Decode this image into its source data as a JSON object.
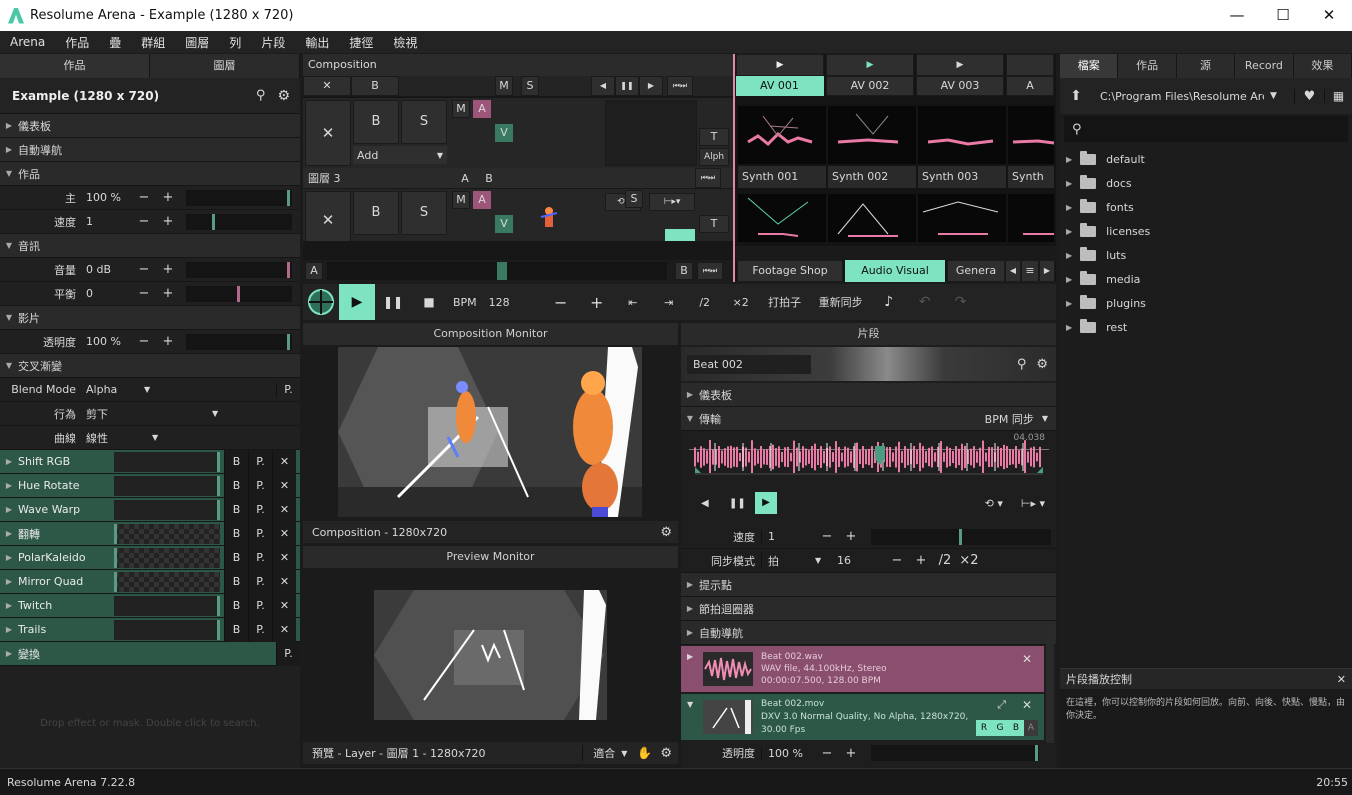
{
  "window": {
    "app_name": "Resolume Arena - Example (1280 x 720)",
    "min": "—",
    "max": "☐",
    "close": "✕"
  },
  "menu": [
    "Arena",
    "作品",
    "疊",
    "群組",
    "圖層",
    "列",
    "片段",
    "輸出",
    "捷徑",
    "檢視"
  ],
  "left": {
    "tabs": [
      "作品",
      "圖層"
    ],
    "header": "Example (1280 x 720)",
    "sections": {
      "dashboard": "儀表板",
      "autopilot": "自動導航",
      "comp": "作品",
      "audio": "音訊",
      "video": "影片",
      "crossfade": "交叉漸變"
    },
    "params": {
      "master": {
        "label": "主",
        "value": "100 %",
        "fill": 0.97
      },
      "speed": {
        "label": "速度",
        "value": "1",
        "fill": 0.25
      },
      "volume": {
        "label": "音量",
        "value": "0 dB",
        "fill": 0.97
      },
      "pan": {
        "label": "平衡",
        "value": "0",
        "fill": 0.5
      },
      "opacity": {
        "label": "透明度",
        "value": "100 %",
        "fill": 0.97
      },
      "blend": {
        "label": "Blend Mode",
        "value": "Alpha"
      },
      "behaviour": {
        "label": "行為",
        "value": "剪下"
      },
      "curve": {
        "label": "曲線",
        "value": "線性"
      }
    },
    "effects": [
      {
        "name": "Shift RGB"
      },
      {
        "name": "Hue Rotate"
      },
      {
        "name": "Wave Warp"
      },
      {
        "name": "翻轉"
      },
      {
        "name": "PolarKaleido"
      },
      {
        "name": "Mirror Quad"
      },
      {
        "name": "Twitch"
      },
      {
        "name": "Trails"
      }
    ],
    "transform": "變換",
    "fx_b": "B",
    "fx_p": "P.",
    "fx_x": "✕",
    "drop_hint": "Drop effect or mask. Double click to search."
  },
  "comp": {
    "title": "Composition",
    "btn_x": "✕",
    "btn_b": "B",
    "btn_m": "M",
    "btn_s": "S",
    "btn_a": "A",
    "btn_v": "V",
    "btn_t": "T",
    "alph": "Alph",
    "add": "Add",
    "layer3": "圖層 3",
    "columns": [
      "AV 001",
      "AV 002",
      "AV 003",
      "A"
    ],
    "clips_row1": [
      "Synth 001",
      "Synth 002",
      "Synth 003",
      "Synth"
    ],
    "tabs": [
      "Footage Shop",
      "Audio Visual",
      "Genera"
    ],
    "transport": {
      "bpm_label": "BPM",
      "bpm": "128",
      "half": "/2",
      "double": "×2",
      "tap": "打拍子",
      "resync": "重新同步"
    }
  },
  "monitors": {
    "comp": {
      "title": "Composition Monitor",
      "footer": "Composition - 1280x720"
    },
    "preview": {
      "title": "Preview Monitor",
      "footer": "預覽 - Layer - 圖層 1 - 1280x720",
      "fit": "適合"
    }
  },
  "clip": {
    "title": "片段",
    "name": "Beat 002",
    "dashboard": "儀表板",
    "transport": "傳輸",
    "bpm_sync": "BPM 同步",
    "time": "04.038",
    "speed": {
      "label": "速度",
      "value": "1",
      "fill": 0.45
    },
    "sync": {
      "label": "同步模式",
      "value": "拍",
      "beats": "16",
      "half": "/2",
      "double": "×2"
    },
    "cue": "提示點",
    "beat_looper": "節拍迴圈器",
    "autopilot": "自動導航",
    "audio_file": {
      "name": "Beat 002.wav",
      "line1": "WAV file, 44.100kHz, Stereo",
      "line2": "00:00:07.500, 128.00 BPM"
    },
    "video_file": {
      "name": "Beat 002.mov",
      "line1": "DXV 3.0 Normal Quality, No Alpha, 1280x720,",
      "line2": "30.00 Fps",
      "r": "R",
      "g": "G",
      "b": "B",
      "a": "A"
    },
    "opacity": {
      "label": "透明度",
      "value": "100 %",
      "fill": 0.97
    }
  },
  "browser": {
    "tabs": [
      "檔案",
      "作品",
      "源",
      "Record",
      "效果"
    ],
    "path": "C:\\Program Files\\Resolume Arena",
    "folders": [
      "default",
      "docs",
      "fonts",
      "licenses",
      "luts",
      "media",
      "plugins",
      "rest"
    ],
    "help_title": "片段播放控制",
    "help_text": "在這裡，你可以控制你的片段如何回放。向前、向後、快點、慢點，由你決定。"
  },
  "status": {
    "version": "Resolume Arena 7.22.8",
    "clock": "20:55"
  },
  "colors": {
    "accent": "#7de3c0",
    "fx_row": "#2d5848",
    "audio_row": "#8a4f6e",
    "video_row": "#2d5848",
    "pink": "#e87aa5"
  }
}
